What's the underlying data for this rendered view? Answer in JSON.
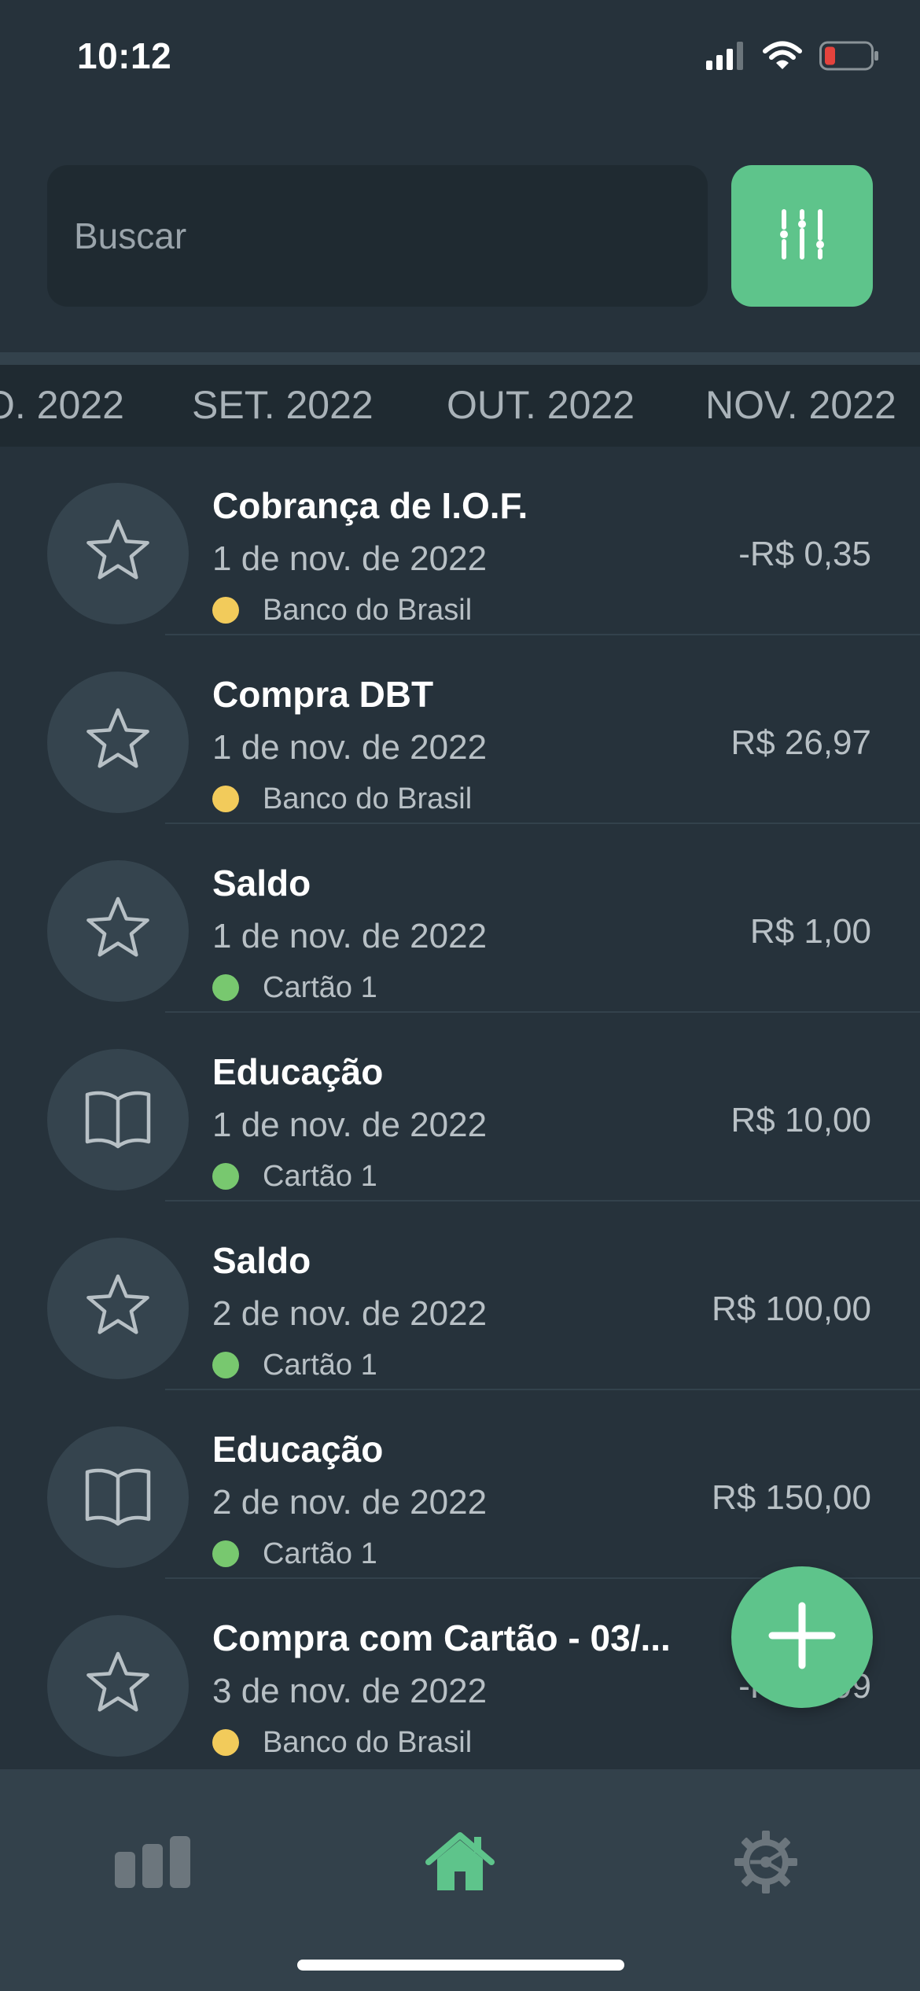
{
  "status_bar": {
    "time": "10:12",
    "icons": [
      "cellular-signal-icon",
      "wifi-icon",
      "battery-low-icon"
    ]
  },
  "search": {
    "placeholder": "Buscar",
    "value": ""
  },
  "filter_button": {
    "icon": "sliders-icon"
  },
  "months": [
    {
      "label": "O. 2022"
    },
    {
      "label": "SET. 2022"
    },
    {
      "label": "OUT. 2022"
    },
    {
      "label": "NOV. 2022"
    }
  ],
  "transactions": [
    {
      "title": "Cobrança de I.O.F.",
      "date": "1 de nov. de 2022",
      "account": "Banco do Brasil",
      "account_color": "#f2cb5b",
      "amount": "-R$ 0,35",
      "icon": "star-icon"
    },
    {
      "title": "Compra DBT",
      "date": "1 de nov. de 2022",
      "account": "Banco do Brasil",
      "account_color": "#f2cb5b",
      "amount": "R$ 26,97",
      "icon": "star-icon"
    },
    {
      "title": "Saldo",
      "date": "1 de nov. de 2022",
      "account": "Cartão 1",
      "account_color": "#78c86f",
      "amount": "R$ 1,00",
      "icon": "star-icon"
    },
    {
      "title": "Educação",
      "date": "1 de nov. de 2022",
      "account": "Cartão 1",
      "account_color": "#78c86f",
      "amount": "R$ 10,00",
      "icon": "book-icon"
    },
    {
      "title": "Saldo",
      "date": "2 de nov. de 2022",
      "account": "Cartão 1",
      "account_color": "#78c86f",
      "amount": "R$ 100,00",
      "icon": "star-icon"
    },
    {
      "title": "Educação",
      "date": "2 de nov. de 2022",
      "account": "Cartão 1",
      "account_color": "#78c86f",
      "amount": "R$ 150,00",
      "icon": "book-icon"
    },
    {
      "title": "Compra com Cartão - 03/...",
      "date": "3 de nov. de 2022",
      "account": "Banco do Brasil",
      "account_color": "#f2cb5b",
      "amount": "-R$ 9,99",
      "icon": "star-icon"
    }
  ],
  "fab": {
    "icon": "plus-icon"
  },
  "tab_bar": [
    {
      "name": "stats",
      "icon": "bar-chart-icon",
      "active": false
    },
    {
      "name": "home",
      "icon": "home-icon",
      "active": true
    },
    {
      "name": "settings",
      "icon": "gear-icon",
      "active": false
    }
  ],
  "colors": {
    "accent": "#5ec48b",
    "background": "#26323b",
    "surface": "#1f2a31",
    "tab_bar": "#33414b"
  }
}
